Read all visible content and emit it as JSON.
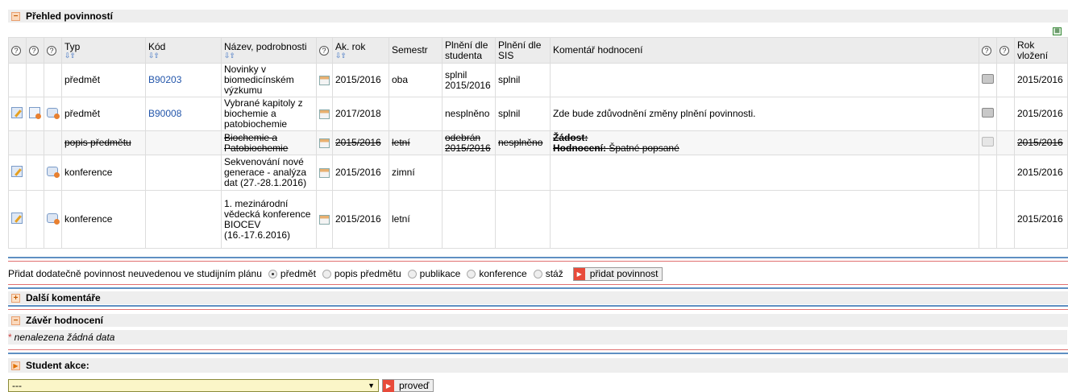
{
  "overview": {
    "title": "Přehled povinností",
    "columns": {
      "typ": "Typ",
      "kod": "Kód",
      "nazev": "Název, podrobnosti",
      "akrok": "Ak. rok",
      "semestr": "Semestr",
      "plneni_student": "Plnění dle studenta",
      "plneni_sis": "Plnění dle SIS",
      "komentar": "Komentář hodnocení",
      "rok_vlozeni": "Rok vložení"
    },
    "rows": [
      {
        "typ": "předmět",
        "kod": "B90203",
        "nazev": "Novinky v biomedicínském výzkumu",
        "akrok": "2015/2016",
        "semestr": "oba",
        "plneni_student": "splnil 2015/2016",
        "plneni_sis": "splnil",
        "komentar": "",
        "rok": "2015/2016"
      },
      {
        "typ": "předmět",
        "kod": "B90008",
        "nazev": "Vybrané kapitoly z biochemie a patobiochemie",
        "akrok": "2017/2018",
        "semestr": "",
        "plneni_student": "nesplněno",
        "plneni_sis": "splnil",
        "komentar": "Zde bude zdůvodnění změny plnění povinnosti.",
        "rok": "2015/2016"
      },
      {
        "typ": "popis předmětu",
        "kod": "",
        "nazev": "Biochemie a Patobiochemie",
        "akrok": "2015/2016",
        "semestr": "letní",
        "plneni_student": "odebrán 2015/2016",
        "plneni_sis": "nesplněno",
        "komentar_zadost": "Žádost:",
        "komentar_hodnoceni_label": "Hodnocení:",
        "komentar_hodnoceni_text": "Špatné popsané",
        "rok": "2015/2016"
      },
      {
        "typ": "konference",
        "kod": "",
        "nazev": "Sekvenování nové generace - analýza dat (27.-28.1.2016)",
        "akrok": "2015/2016",
        "semestr": "zimní",
        "plneni_student": "",
        "plneni_sis": "",
        "komentar": "",
        "rok": "2015/2016"
      },
      {
        "typ": "konference",
        "kod": "",
        "nazev": "1. mezinárodní vědecká konference BIOCEV (16.-17.6.2016)",
        "akrok": "2015/2016",
        "semestr": "letní",
        "plneni_student": "",
        "plneni_sis": "",
        "komentar": "",
        "rok": "2015/2016"
      }
    ]
  },
  "add_obligation": {
    "label": "Přidat dodatečně povinnost neuvedenou ve studijním plánu",
    "options": [
      "předmět",
      "popis předmětu",
      "publikace",
      "konference",
      "stáž"
    ],
    "selected": "předmět",
    "button": "přidat povinnost"
  },
  "more_comments": {
    "title": "Další komentáře"
  },
  "conclusion": {
    "title": "Závěr hodnocení",
    "empty": "nenalezena žádná data"
  },
  "student_action": {
    "title": "Student akce:",
    "select_value": "---",
    "button": "proveď"
  },
  "icons": {
    "help": "?"
  }
}
